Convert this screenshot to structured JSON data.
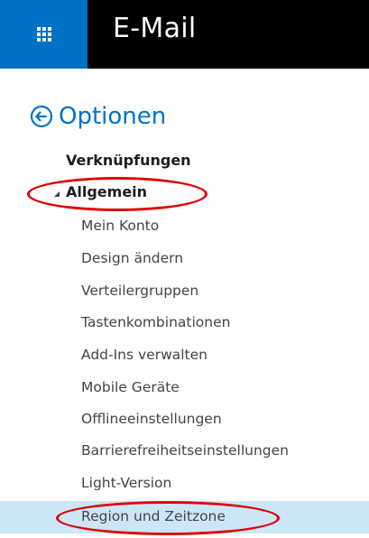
{
  "header": {
    "app_launcher_icon": "waffle-grid-icon",
    "title": "E-Mail",
    "accent_color": "#0072c6"
  },
  "options": {
    "back_icon": "back-arrow-circle-icon",
    "title": "Optionen"
  },
  "nav": {
    "shortcuts": "Verknüpfungen",
    "general": "Allgemein",
    "general_expanded_icon": "triangle-expanded-icon",
    "sub_items": [
      "Mein Konto",
      "Design ändern",
      "Verteilergruppen",
      "Tastenkombinationen",
      "Add-Ins verwalten",
      "Mobile Geräte",
      "Offlineeinstellungen",
      "Barrierefreiheitseinstellungen",
      "Light-Version",
      "Region und Zeitzone"
    ],
    "selected": "Region und Zeitzone",
    "selected_color": "#cde6f7",
    "annotation_color": "#e00000"
  }
}
